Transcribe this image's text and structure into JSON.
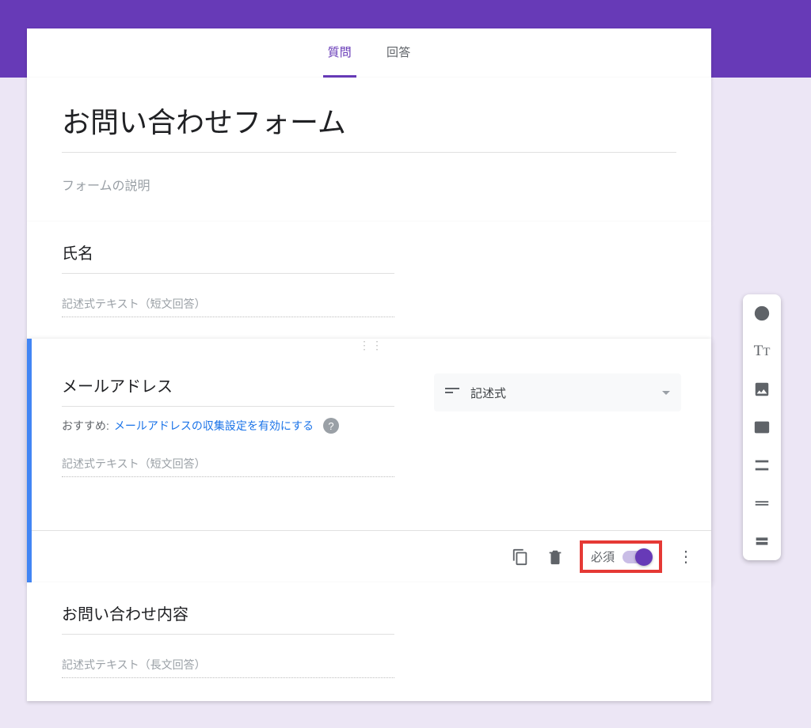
{
  "tabs": {
    "questions": "質問",
    "responses": "回答"
  },
  "form": {
    "title": "お問い合わせフォーム",
    "description_placeholder": "フォームの説明"
  },
  "q1": {
    "title": "氏名",
    "placeholder": "記述式テキスト（短文回答）"
  },
  "q2": {
    "title": "メールアドレス",
    "type_label": "記述式",
    "hint_prefix": "おすすめ:",
    "hint_link": "メールアドレスの収集設定を有効にする",
    "placeholder": "記述式テキスト（短文回答）",
    "required_label": "必須"
  },
  "q3": {
    "title": "お問い合わせ内容",
    "placeholder": "記述式テキスト（長文回答）"
  }
}
